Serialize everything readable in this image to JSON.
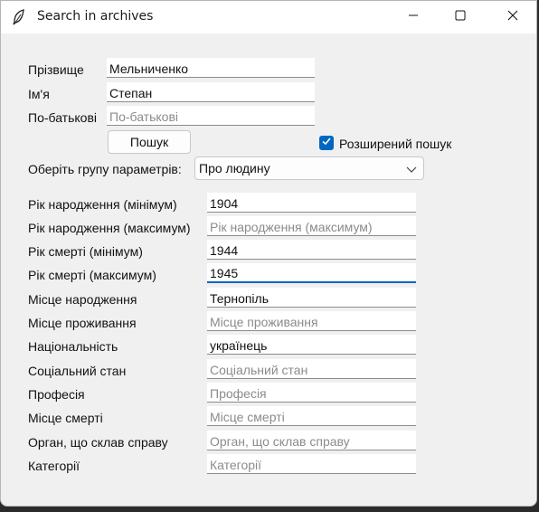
{
  "window": {
    "title": "Search in archives",
    "app_icon": "feather-icon",
    "controls": [
      "minimize-icon",
      "maximize-icon",
      "close-icon"
    ]
  },
  "name_fields": [
    {
      "label": "Прізвище",
      "value": "Мельниченко",
      "placeholder": "Прізвище"
    },
    {
      "label": "Ім'я",
      "value": "Степан",
      "placeholder": "Ім'я"
    },
    {
      "label": "По-батькові",
      "value": "",
      "placeholder": "По-батькові"
    }
  ],
  "search_button": {
    "label": "Пошук"
  },
  "advanced_search": {
    "label": "Розширений пошук",
    "checked": true
  },
  "param_group": {
    "label": "Оберіть групу параметрів:",
    "selected": "Про людину"
  },
  "params": [
    {
      "label": "Рік народження (мінімум)",
      "value": "1904",
      "placeholder": "Рік народження (мінімум)"
    },
    {
      "label": "Рік народження (максимум)",
      "value": "",
      "placeholder": "Рік народження (максимум)"
    },
    {
      "label": "Рік смерті (мінімум)",
      "value": "1944",
      "placeholder": "Рік смерті (мінімум)"
    },
    {
      "label": "Рік смерті (максимум)",
      "value": "1945",
      "placeholder": "Рік смерті (максимум)"
    },
    {
      "label": "Місце народження",
      "value": "Тернопіль",
      "placeholder": "Місце народження"
    },
    {
      "label": "Місце проживання",
      "value": "",
      "placeholder": "Місце проживання"
    },
    {
      "label": "Національність",
      "value": "українець",
      "placeholder": "Національність"
    },
    {
      "label": "Соціальний стан",
      "value": "",
      "placeholder": "Соціальний стан"
    },
    {
      "label": "Професія",
      "value": "",
      "placeholder": "Професія"
    },
    {
      "label": "Місце смерті",
      "value": "",
      "placeholder": "Місце смерті"
    },
    {
      "label": "Орган, що склав справу",
      "value": "",
      "placeholder": "Орган, що склав справу"
    },
    {
      "label": "Категорії",
      "value": "",
      "placeholder": "Категорії"
    }
  ],
  "colors": {
    "accent": "#0067c0",
    "window_bg": "#f0f0f0",
    "titlebar_bg": "#ffffff"
  }
}
